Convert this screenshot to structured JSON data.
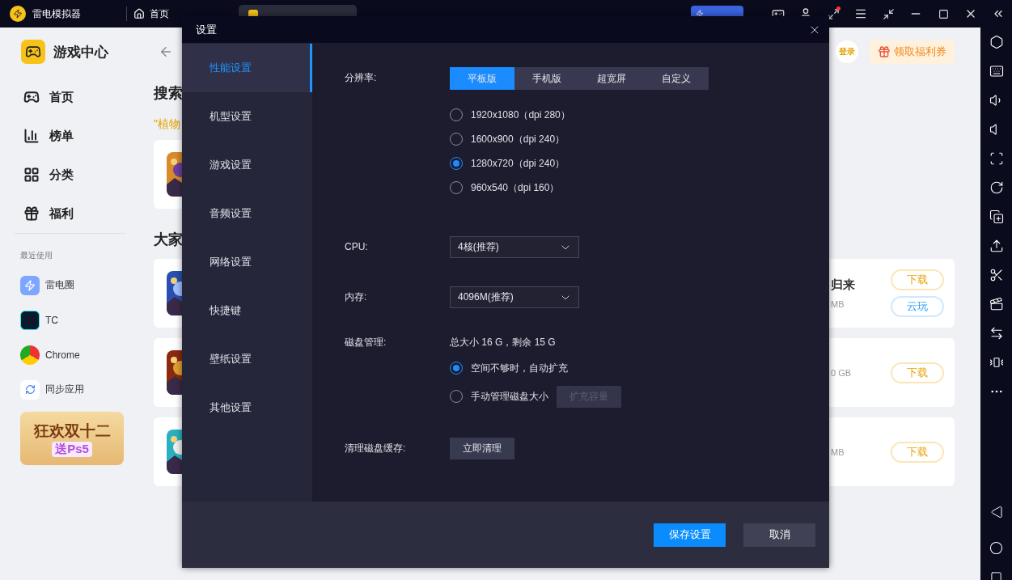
{
  "app_bar": {
    "title": "雷电模拟器",
    "home_tab": "首页"
  },
  "sidebar": {
    "title": "游戏中心",
    "nav": [
      {
        "label": "首页",
        "kind": "home"
      },
      {
        "label": "榜单",
        "kind": "rank"
      },
      {
        "label": "分类",
        "kind": "category"
      },
      {
        "label": "福利",
        "kind": "gift"
      }
    ],
    "recent_heading": "最近使用",
    "recent": [
      {
        "label": "雷电圈",
        "kind": "circle"
      },
      {
        "label": "TC",
        "kind": "tc"
      },
      {
        "label": "Chrome",
        "kind": "chrome"
      },
      {
        "label": "同步应用",
        "kind": "sync"
      }
    ],
    "promo": {
      "line1": "狂欢双十二",
      "line2": "送Ps5"
    }
  },
  "content": {
    "search_heading": "搜索",
    "query_fragment": "\"植物",
    "section_heading": "大家",
    "login": "登录",
    "coupon": "领取福利券",
    "games": [
      {
        "name_fragment": "归来",
        "size_fragment": "MB",
        "actions": [
          {
            "label": "下载",
            "kind": "download"
          },
          {
            "label": "云玩",
            "kind": "cloud"
          }
        ]
      },
      {
        "size_fragment": "0 GB",
        "actions": [
          {
            "label": "下载",
            "kind": "download"
          }
        ]
      },
      {
        "size_fragment": "MB",
        "actions": [
          {
            "label": "下载",
            "kind": "download"
          }
        ]
      }
    ]
  },
  "dialog": {
    "title": "设置",
    "tabs": [
      {
        "label": "性能设置",
        "selected": true
      },
      {
        "label": "机型设置",
        "selected": false
      },
      {
        "label": "游戏设置",
        "selected": false
      },
      {
        "label": "音频设置",
        "selected": false
      },
      {
        "label": "网络设置",
        "selected": false
      },
      {
        "label": "快捷键",
        "selected": false
      },
      {
        "label": "壁纸设置",
        "selected": false
      },
      {
        "label": "其他设置",
        "selected": false
      }
    ],
    "resolution": {
      "label": "分辨率:",
      "modes": [
        {
          "label": "平板版",
          "selected": true
        },
        {
          "label": "手机版",
          "selected": false
        },
        {
          "label": "超宽屏",
          "selected": false
        },
        {
          "label": "自定义",
          "selected": false
        }
      ],
      "options": [
        {
          "label": "1920x1080（dpi 280）",
          "selected": false
        },
        {
          "label": "1600x900（dpi 240）",
          "selected": false
        },
        {
          "label": "1280x720（dpi 240）",
          "selected": true
        },
        {
          "label": "960x540（dpi 160）",
          "selected": false
        }
      ]
    },
    "cpu": {
      "label": "CPU:",
      "value": "4核(推荐)"
    },
    "memory": {
      "label": "内存:",
      "value": "4096M(推荐)"
    },
    "disk": {
      "label": "磁盘管理:",
      "summary": "总大小 16 G，剩余 15 G",
      "options": [
        {
          "label": "空间不够时，自动扩充",
          "selected": true
        },
        {
          "label": "手动管理磁盘大小",
          "selected": false
        }
      ],
      "expand_button": {
        "label": "扩充容量",
        "disabled": true
      }
    },
    "cache": {
      "label": "清理磁盘缓存:",
      "button": "立即清理"
    },
    "buttons": [
      {
        "label": "保存设置",
        "kind": "primary"
      },
      {
        "label": "取消",
        "kind": "secondary"
      }
    ]
  }
}
